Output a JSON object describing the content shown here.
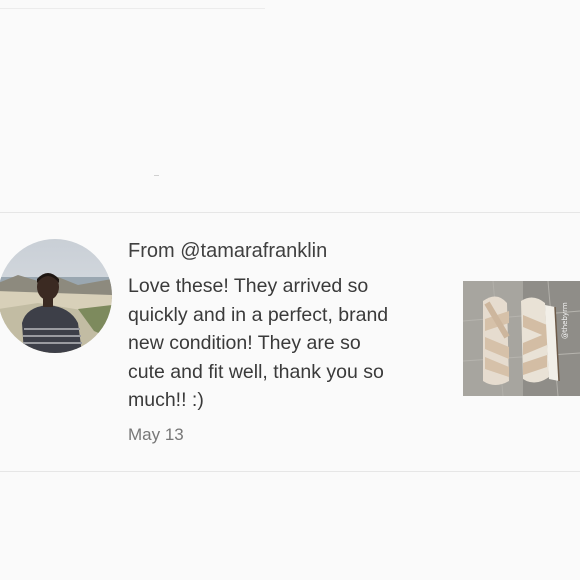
{
  "review": {
    "from": "From @tamarafranklin",
    "text": "Love these! They arrived so\nquickly and in a perfect, brand\nnew condition! They are so\ncute and fit well, thank you so\nmuch!! :)",
    "date": "May 13",
    "avatar_icon": "user-photo",
    "product_icon": "sandal-photo",
    "product_watermark": "@thebyrm"
  },
  "colors": {
    "background": "#fafafa",
    "divider": "#e6e6e6",
    "text": "#3a3a3a",
    "date": "#777777"
  }
}
